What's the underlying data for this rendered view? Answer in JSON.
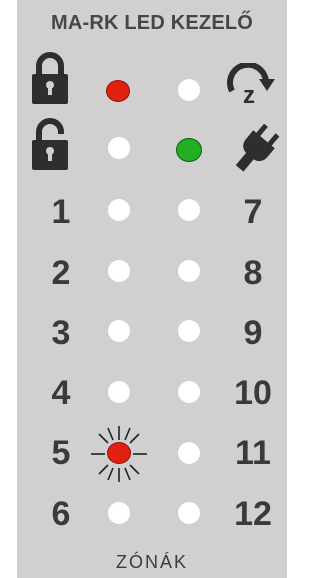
{
  "header": {
    "title": "MA-RK LED KEZELŐ"
  },
  "footer": {
    "label": "ZÓNÁK"
  },
  "status_row_1": {
    "left_icon": "locked-padlock-icon",
    "left_led": "red",
    "right_led": "white",
    "right_icon": "rotate-z-icon"
  },
  "status_row_2": {
    "left_icon": "unlocked-padlock-icon",
    "left_led": "white",
    "right_led": "green",
    "right_icon": "power-plug-icon"
  },
  "zones": {
    "left": [
      {
        "number": "1",
        "led": "white"
      },
      {
        "number": "2",
        "led": "white"
      },
      {
        "number": "3",
        "led": "white"
      },
      {
        "number": "4",
        "led": "white"
      },
      {
        "number": "5",
        "led": "red-blinking"
      },
      {
        "number": "6",
        "led": "white"
      }
    ],
    "right": [
      {
        "number": "7",
        "led": "white"
      },
      {
        "number": "8",
        "led": "white"
      },
      {
        "number": "9",
        "led": "white"
      },
      {
        "number": "10",
        "led": "white"
      },
      {
        "number": "11",
        "led": "white"
      },
      {
        "number": "12",
        "led": "white"
      }
    ]
  },
  "colors": {
    "panel": "#d0d0d0",
    "text": "#3a3a3a",
    "led_red": "#e02010",
    "led_green": "#22b022",
    "led_off": "#ffffff"
  }
}
